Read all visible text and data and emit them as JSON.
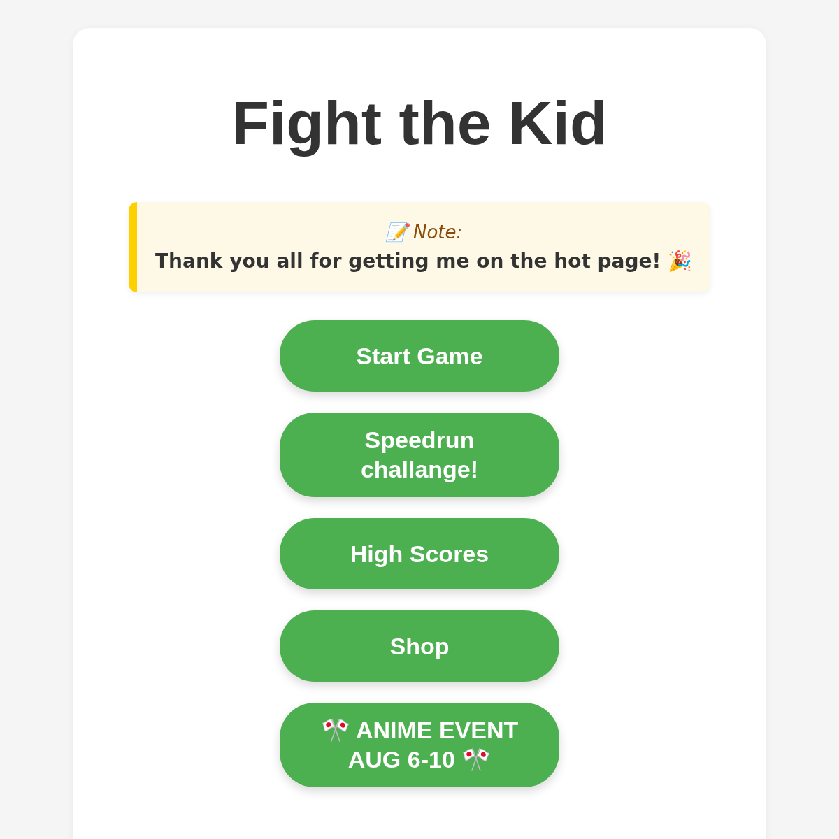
{
  "title": "Fight the Kid",
  "note": {
    "label": "📝 Note:",
    "message": "Thank you all for getting me on the hot page! 🎉"
  },
  "buttons": [
    {
      "label": "Start Game"
    },
    {
      "label": "Speedrun challange!"
    },
    {
      "label": "High Scores"
    },
    {
      "label": "Shop"
    },
    {
      "label": "🎌 ANIME EVENT AUG 6-10 🎌"
    }
  ]
}
